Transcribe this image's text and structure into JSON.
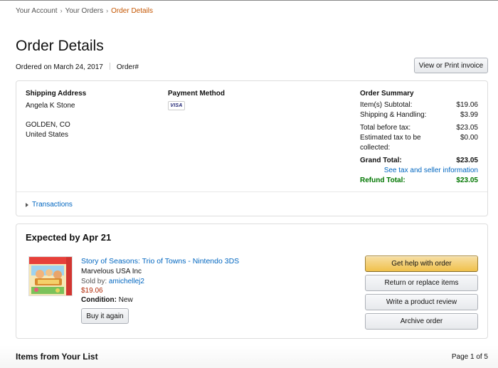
{
  "breadcrumb": {
    "items": [
      "Your Account",
      "Your Orders"
    ],
    "current": "Order Details"
  },
  "page": {
    "title": "Order Details",
    "ordered_on": "Ordered on March 24, 2017",
    "order_number_label": "Order#",
    "invoice_button": "View or Print invoice"
  },
  "shipping": {
    "heading": "Shipping Address",
    "name": "Angela K Stone",
    "city_state": "GOLDEN, CO",
    "country": "United States"
  },
  "payment": {
    "heading": "Payment Method",
    "card_brand": "VISA"
  },
  "summary": {
    "heading": "Order Summary",
    "subtotal_label": "Item(s) Subtotal:",
    "subtotal_value": "$19.06",
    "shipping_label": "Shipping & Handling:",
    "shipping_value": "$3.99",
    "before_tax_label": "Total before tax:",
    "before_tax_value": "$23.05",
    "tax_label_line1": "Estimated tax to be",
    "tax_label_line2": "collected:",
    "tax_value": "$0.00",
    "grand_total_label": "Grand Total:",
    "grand_total_value": "$23.05",
    "tax_info_link": "See tax and seller information",
    "refund_label": "Refund Total:",
    "refund_value": "$23.05"
  },
  "transactions": {
    "label": "Transactions"
  },
  "shipment": {
    "heading": "Expected by Apr 21",
    "product_title": "Story of Seasons: Trio of Towns - Nintendo 3DS",
    "publisher": "Marvelous USA Inc",
    "sold_by_label": "Sold by:",
    "seller": "amichellej2",
    "price": "$19.06",
    "condition_label": "Condition:",
    "condition_value": "New",
    "buy_again": "Buy it again",
    "actions": {
      "help": "Get help with order",
      "return": "Return or replace items",
      "review": "Write a product review",
      "archive": "Archive order"
    }
  },
  "list_section": {
    "heading": "Items from Your List",
    "page_indicator": "Page 1 of 5"
  },
  "colors": {
    "link": "#0066c0",
    "breadcrumb_current": "#c45500",
    "price": "#b12704",
    "refund": "#007600",
    "primary_button": "#f0c14b"
  }
}
